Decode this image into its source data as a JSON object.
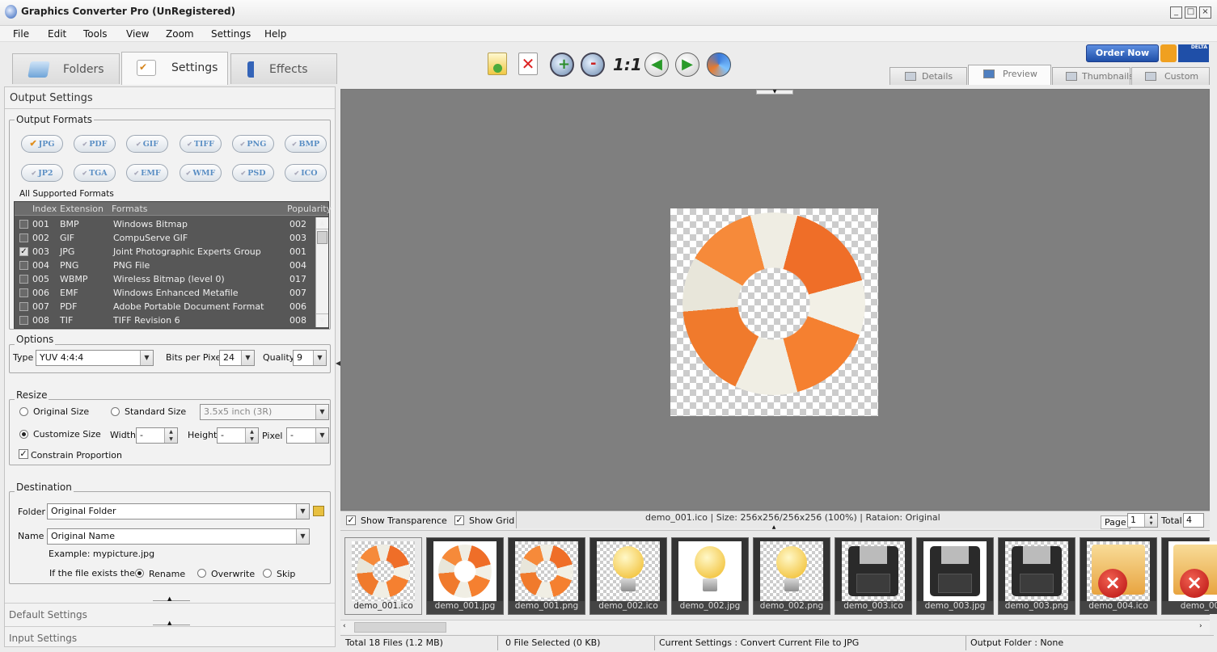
{
  "window": {
    "title": "Graphics Converter Pro  (UnRegistered)"
  },
  "menu": [
    "File",
    "Edit",
    "Tools",
    "View",
    "Zoom",
    "Settings",
    "Help"
  ],
  "main_tabs": [
    {
      "label": "Folders"
    },
    {
      "label": "Settings"
    },
    {
      "label": "Effects"
    }
  ],
  "toolbar": {
    "icons": [
      "add-file-icon",
      "delete-file-icon",
      "zoom-in-icon",
      "zoom-out-icon",
      "actual-size-icon",
      "previous-icon",
      "next-icon",
      "convert-icon"
    ],
    "actual_size_label": "1:1"
  },
  "order": {
    "label": "Order Now",
    "brand": "DELTA"
  },
  "view_tabs": [
    {
      "label": "Details"
    },
    {
      "label": "Preview"
    },
    {
      "label": "Thumbnails"
    },
    {
      "label": "Custom"
    }
  ],
  "left": {
    "title": "Output Settings",
    "output_formats": {
      "label": "Output Formats",
      "row1": [
        "JPG",
        "PDF",
        "GIF",
        "TIFF",
        "PNG",
        "BMP"
      ],
      "row2": [
        "JP2",
        "TGA",
        "EMF",
        "WMF",
        "PSD",
        "ICO"
      ],
      "selected": "JPG"
    },
    "all_formats_label": "All Supported Formats",
    "table": {
      "headers": [
        "Index",
        "Extension",
        "Formats",
        "Popularity"
      ],
      "rows": [
        {
          "index": "001",
          "ext": "BMP",
          "name": "Windows Bitmap",
          "pop": "002",
          "checked": false
        },
        {
          "index": "002",
          "ext": "GIF",
          "name": "CompuServe GIF",
          "pop": "003",
          "checked": false
        },
        {
          "index": "003",
          "ext": "JPG",
          "name": "Joint Photographic Experts Group",
          "pop": "001",
          "checked": true
        },
        {
          "index": "004",
          "ext": "PNG",
          "name": "PNG File",
          "pop": "004",
          "checked": false
        },
        {
          "index": "005",
          "ext": "WBMP",
          "name": "Wireless Bitmap (level 0)",
          "pop": "017",
          "checked": false
        },
        {
          "index": "006",
          "ext": "EMF",
          "name": "Windows Enhanced Metafile",
          "pop": "007",
          "checked": false
        },
        {
          "index": "007",
          "ext": "PDF",
          "name": "Adobe Portable Document Format",
          "pop": "006",
          "checked": false
        },
        {
          "index": "008",
          "ext": "TIF",
          "name": "TIFF Revision 6",
          "pop": "008",
          "checked": false
        }
      ]
    },
    "options": {
      "label": "Options",
      "type_label": "Type",
      "type_value": "YUV 4:4:4",
      "bpp_label": "Bits per Pixel",
      "bpp_value": "24",
      "quality_label": "Quality",
      "quality_value": "9"
    },
    "resize": {
      "label": "Resize",
      "original": "Original Size",
      "standard": "Standard Size",
      "standard_value": "3.5x5 inch (3R)",
      "customize": "Customize Size",
      "width_label": "Width",
      "width_value": "-",
      "height_label": "Height",
      "height_value": "-",
      "unit_label": "Pixel",
      "unit_value": "-",
      "constrain": "Constrain Proportion"
    },
    "destination": {
      "label": "Destination",
      "folder_label": "Folder",
      "folder_value": "Original Folder",
      "name_label": "Name",
      "name_value": "Original Name",
      "example": "Example: mypicture.jpg",
      "exists_label": "If the file exists then",
      "rename": "Rename",
      "overwrite": "Overwrite",
      "skip": "Skip"
    },
    "default_settings": "Default Settings",
    "input_settings": "Input Settings"
  },
  "preview": {
    "show_transparence": "Show Transparence",
    "show_grid": "Show Grid",
    "info": "demo_001.ico  |  Size: 256x256/256x256 (100%)  |  Rataion: Original",
    "page_label": "Page",
    "page_value": "1",
    "total_label": "Total",
    "total_value": "4"
  },
  "thumbnails": [
    {
      "name": "demo_001.ico",
      "icon": "lifebuoy-icon"
    },
    {
      "name": "demo_001.jpg",
      "icon": "lifebuoy-icon"
    },
    {
      "name": "demo_001.png",
      "icon": "lifebuoy-icon"
    },
    {
      "name": "demo_002.ico",
      "icon": "lightbulb-icon"
    },
    {
      "name": "demo_002.jpg",
      "icon": "lightbulb-icon"
    },
    {
      "name": "demo_002.png",
      "icon": "lightbulb-icon"
    },
    {
      "name": "demo_003.ico",
      "icon": "floppy-disk-icon"
    },
    {
      "name": "demo_003.jpg",
      "icon": "floppy-disk-icon"
    },
    {
      "name": "demo_003.png",
      "icon": "floppy-disk-icon"
    },
    {
      "name": "demo_004.ico",
      "icon": "folder-delete-icon"
    },
    {
      "name": "demo_00",
      "icon": "folder-delete-icon"
    }
  ],
  "status": {
    "total": "Total 18 Files (1.2 MB)",
    "selected": "0 File Selected (0 KB)",
    "current": "Current Settings : Convert Current File to JPG",
    "output": "Output Folder : None"
  }
}
